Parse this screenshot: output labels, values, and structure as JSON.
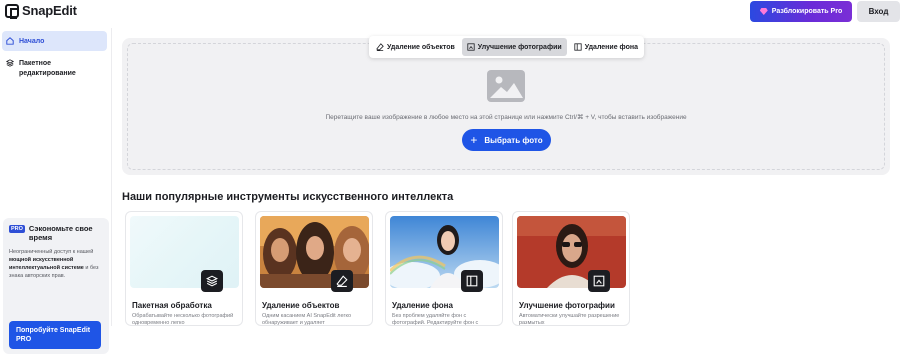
{
  "app": {
    "name": "SnapEdit"
  },
  "header": {
    "pro_button": "Разблокировать Pro",
    "login_button": "Вход"
  },
  "sidebar": {
    "items": [
      {
        "label": "Начало",
        "active": true
      },
      {
        "label": "Пакетное редактирование",
        "active": false
      }
    ],
    "promo": {
      "badge": "PRO",
      "title": "Сэкономьте свое время",
      "body_1": "Неограниченный доступ к нашей ",
      "body_bold": "мощной искусственной интеллектуальной системе",
      "body_2": " и без знака авторских прав.",
      "button": "Попробуйте SnapEdit PRO"
    }
  },
  "tabs": [
    {
      "label": "Удаление объектов",
      "icon": "eraser-icon",
      "active": false
    },
    {
      "label": "Улучшение фотографии",
      "icon": "enhance-icon",
      "active": true
    },
    {
      "label": "Удаление фона",
      "icon": "background-remove-icon",
      "active": false
    }
  ],
  "upload": {
    "hint": "Перетащите ваше изображение в любое место на этой странице или нажмите Ctrl/⌘ + V, чтобы вставить изображение",
    "button": "Выбрать фото"
  },
  "tools": {
    "title": "Наши популярные инструменты искусственного интеллекта",
    "cards": [
      {
        "title": "Пакетная обработка",
        "desc": "Обрабатывайте несколько фотографий одновременно легко",
        "icon": "layers-icon"
      },
      {
        "title": "Удаление объектов",
        "desc": "Одним касанием AI SnapEdit легко обнаруживает и удаляет",
        "icon": "eraser-icon"
      },
      {
        "title": "Удаление фона",
        "desc": "Без проблем удаляйте фон с фотографий. Редактируйте фон с",
        "icon": "background-remove-icon"
      },
      {
        "title": "Улучшение фотографии",
        "desc": "Автоматически улучшайте разрешение размытых",
        "icon": "enhance-icon"
      }
    ]
  },
  "colors": {
    "accent": "#1f55e6",
    "pro_gradient_start": "#2b49e0",
    "pro_gradient_end": "#7a2fd6"
  }
}
